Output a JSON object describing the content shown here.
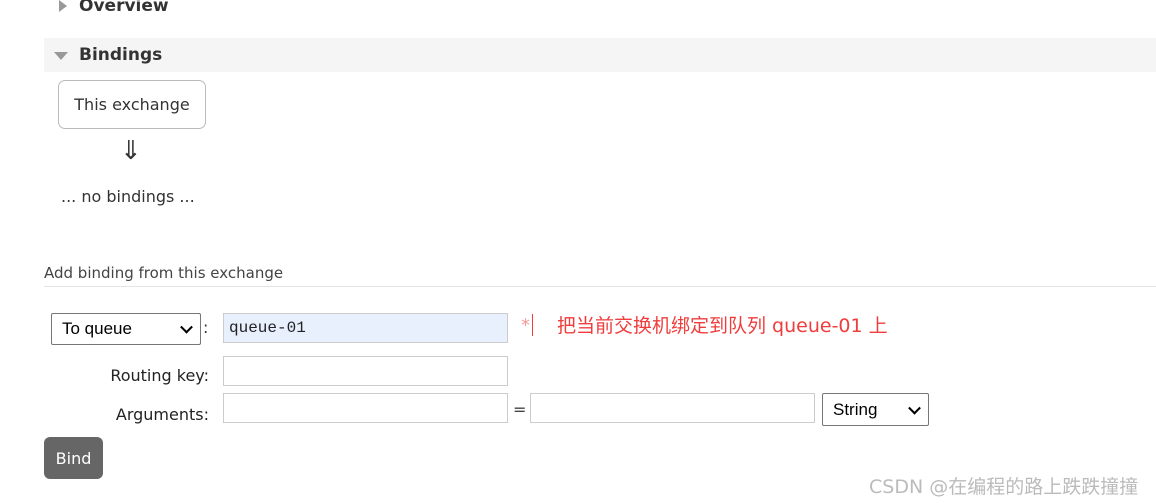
{
  "sections": {
    "overview": {
      "label": "Overview",
      "expanded": false
    },
    "bindings": {
      "label": "Bindings",
      "expanded": true
    }
  },
  "bindings_diagram": {
    "source_label": "This exchange",
    "arrow": "⇓",
    "empty_text": "... no bindings ..."
  },
  "add_binding": {
    "heading": "Add binding from this exchange",
    "destination_type": {
      "selected": "To queue"
    },
    "colon": ":",
    "destination_value": "queue-01",
    "required_marker": "*",
    "routing_key_label": "Routing key:",
    "routing_key_value": "",
    "arguments_label": "Arguments:",
    "arguments_key": "",
    "equals": "=",
    "arguments_value": "",
    "arguments_type": {
      "selected": "String"
    },
    "bind_button": "Bind"
  },
  "annotation": {
    "text": "把当前交换机绑定到队列 queue-01 上",
    "color": "#f03c3c"
  },
  "watermark": "CSDN @在编程的路上跌跌撞撞"
}
